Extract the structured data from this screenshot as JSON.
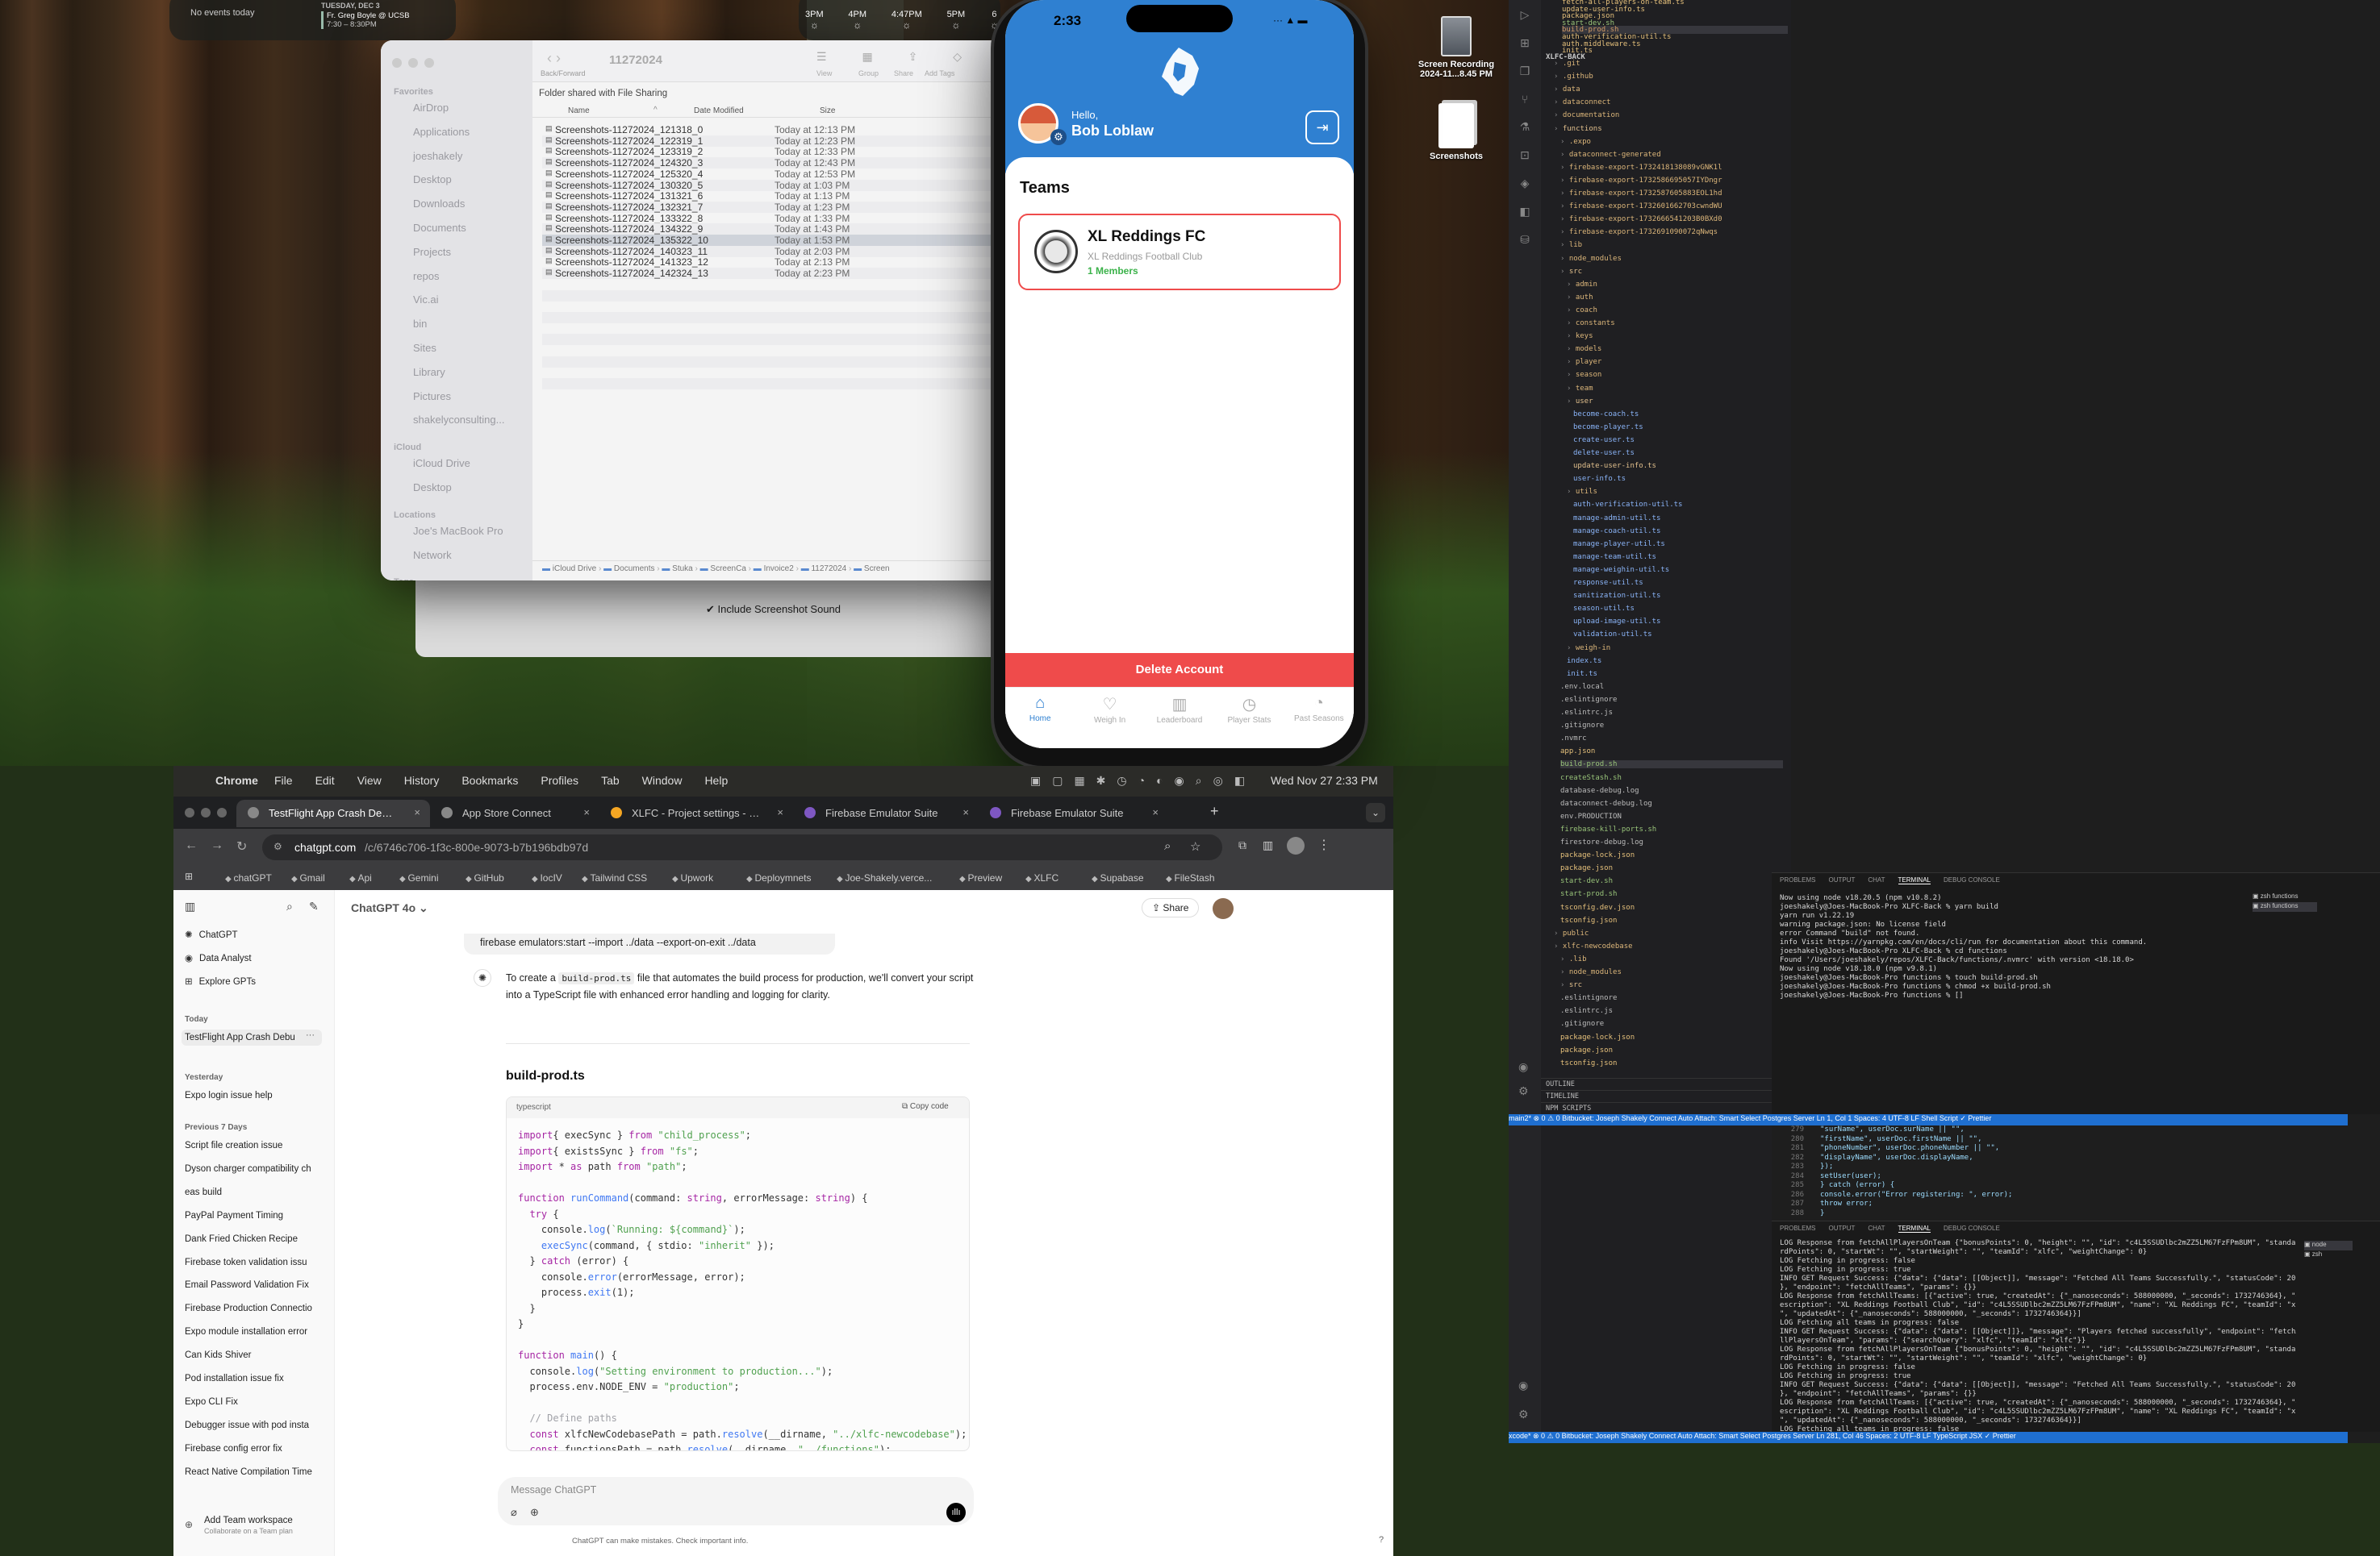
{
  "menubar": {
    "app": "Chrome",
    "items": [
      "File",
      "Edit",
      "View",
      "History",
      "Bookmarks",
      "Profiles",
      "Tab",
      "Window",
      "Help"
    ],
    "clock": "Wed Nov 27  2:33 PM"
  },
  "calendar_widget": {
    "events": "No events today",
    "day": "TUESDAY, DEC 3",
    "event_title": "Fr. Greg Boyle @ UCSB",
    "event_time": "7:30 – 8:30PM"
  },
  "weather_widget": {
    "times": [
      "3PM",
      "4PM",
      "4:47PM",
      "5PM",
      "6"
    ]
  },
  "desktop_icons": [
    {
      "label": "Screen Recording 2024-11...8.45 PM"
    },
    {
      "label": "Screenshots"
    }
  ],
  "finder": {
    "path_title": "11272024",
    "toolbar": {
      "back_forward": "Back/Forward",
      "view": "View",
      "group": "Group",
      "share": "Share",
      "add_tags": "Add Tags"
    },
    "banner": "Folder shared with File Sharing",
    "columns": [
      "Name",
      "Date Modified",
      "Size"
    ],
    "sidebar": {
      "favorites_header": "Favorites",
      "favorites": [
        "AirDrop",
        "Applications",
        "joeshakely",
        "Desktop",
        "Downloads",
        "Documents",
        "Projects",
        "repos",
        "Vic.ai",
        "bin",
        "Sites",
        "Library",
        "Pictures",
        "shakelyconsulting..."
      ],
      "icloud_header": "iCloud",
      "icloud": [
        "iCloud Drive",
        "Desktop"
      ],
      "locations_header": "Locations",
      "locations": [
        "Joe's MacBook Pro",
        "Network"
      ],
      "tags_header": "Tags"
    },
    "files": [
      {
        "name": "Screenshots-11272024_121318_0",
        "date": "Today at 12:13 PM",
        "size": "2."
      },
      {
        "name": "Screenshots-11272024_122319_1",
        "date": "Today at 12:23 PM",
        "size": "2."
      },
      {
        "name": "Screenshots-11272024_123319_2",
        "date": "Today at 12:33 PM",
        "size": "2.7"
      },
      {
        "name": "Screenshots-11272024_124320_3",
        "date": "Today at 12:43 PM",
        "size": "2.8"
      },
      {
        "name": "Screenshots-11272024_125320_4",
        "date": "Today at 12:53 PM",
        "size": "2.7"
      },
      {
        "name": "Screenshots-11272024_130320_5",
        "date": "Today at 1:03 PM",
        "size": "2.8"
      },
      {
        "name": "Screenshots-11272024_131321_6",
        "date": "Today at 1:13 PM",
        "size": "2."
      },
      {
        "name": "Screenshots-11272024_132321_7",
        "date": "Today at 1:23 PM",
        "size": "2."
      },
      {
        "name": "Screenshots-11272024_133322_8",
        "date": "Today at 1:33 PM",
        "size": "2.7"
      },
      {
        "name": "Screenshots-11272024_134322_9",
        "date": "Today at 1:43 PM",
        "size": "2."
      },
      {
        "name": "Screenshots-11272024_135322_10",
        "date": "Today at 1:53 PM",
        "size": "2."
      },
      {
        "name": "Screenshots-11272024_140323_11",
        "date": "Today at 2:03 PM",
        "size": "2.8"
      },
      {
        "name": "Screenshots-11272024_141323_12",
        "date": "Today at 2:13 PM",
        "size": "2.8"
      },
      {
        "name": "Screenshots-11272024_142324_13",
        "date": "Today at 2:23 PM",
        "size": "2."
      }
    ],
    "breadcrumb": [
      "iCloud Drive",
      "Documents",
      "Stuka",
      "ScreenCa",
      "Invoice2",
      "11272024",
      "Screen"
    ],
    "screenshot_sound": "Include Screenshot Sound"
  },
  "phone": {
    "time": "2:33",
    "greeting": "Hello,",
    "user_name": "Bob Loblaw",
    "teams_title": "Teams",
    "team": {
      "name": "XL Reddings FC",
      "subtitle": "XL Reddings Football Club",
      "members": "1 Members"
    },
    "delete_button": "Delete Account",
    "tabs": [
      "Home",
      "Weigh In",
      "Leaderboard",
      "Player Stats",
      "Past Seasons"
    ],
    "colors": {
      "primary": "#2f80d1",
      "danger": "#ef4b4b",
      "member": "#3bb24a"
    }
  },
  "chrome": {
    "tabs": [
      "TestFlight App Crash Debugg",
      "App Store Connect",
      "XLFC - Project settings - Fire",
      "Firebase Emulator Suite",
      "Firebase Emulator Suite"
    ],
    "url_host": "chatgpt.com",
    "url_path": "/c/6746c706-1f3c-800e-9073-b7b196bdb97d",
    "bookmarks": [
      "chatGPT",
      "Gmail",
      "Api",
      "Gemini",
      "GitHub",
      "IocIV",
      "Tailwind CSS",
      "Upwork",
      "Deploymnets",
      "Joe-Shakely.verce...",
      "Preview",
      "XLFC",
      "Supabase",
      "FileStash"
    ]
  },
  "chatgpt": {
    "model": "ChatGPT 4o",
    "share": "Share",
    "sidebar_top": [
      "ChatGPT",
      "Data Analyst",
      "Explore GPTs"
    ],
    "today_header": "Today",
    "today": [
      "TestFlight App Crash Debu"
    ],
    "yesterday_header": "Yesterday",
    "yesterday": [
      "Expo login issue help"
    ],
    "prev7_header": "Previous 7 Days",
    "prev7": [
      "Script file creation issue",
      "Dyson charger compatibility ch",
      "eas build",
      "PayPal Payment Timing",
      "Dank Fried Chicken Recipe",
      "Firebase token validation issu",
      "Email Password Validation Fix",
      "Firebase Production Connectio",
      "Expo module installation error",
      "Can Kids Shiver",
      "Pod installation issue fix",
      "Expo CLI Fix",
      "Debugger issue with pod insta",
      "Firebase config error fix",
      "React Native Compilation Time"
    ],
    "add_workspace": "Add Team workspace",
    "add_workspace_sub": "Collaborate on a Team plan",
    "cmd_line": "firebase emulators:start --import ../data --export-on-exit ../data",
    "answer_a": "To create a ",
    "answer_code": "build-prod.ts",
    "answer_b": " file that automates the build process for production, we'll convert your script into a TypeScript file with enhanced error handling and logging for clarity.",
    "heading": "build-prod.ts",
    "lang": "typescript",
    "copy": "Copy code",
    "input_placeholder": "Message ChatGPT",
    "disclaimer": "ChatGPT can make mistakes. Check important info."
  },
  "vscode": {
    "project": "XLFC-BACK",
    "top_files": [
      "fetch-all-players-on-team.ts",
      "update-user-info.ts",
      "package.json",
      "start-dev.sh",
      "build-prod.sh",
      "auth-verification-util.ts",
      "auth.middleware.ts",
      "init.ts"
    ],
    "tree": [
      ".git",
      ".github",
      "data",
      "dataconnect",
      "documentation",
      "functions",
      ".expo",
      "dataconnect-generated",
      "firebase-export-1732418138089vGNK1l",
      "firebase-export-1732586695057IYDngr",
      "firebase-export-1732587605883EOL1hd",
      "firebase-export-1732601662703cwndWU",
      "firebase-export-1732666541203B0BXd0",
      "firebase-export-1732691090072qNwqs",
      "lib",
      "node_modules",
      "src",
      "admin",
      "auth",
      "coach",
      "constants",
      "keys",
      "models",
      "player",
      "season",
      "team",
      "user",
      "become-coach.ts",
      "become-player.ts",
      "create-user.ts",
      "delete-user.ts",
      "update-user-info.ts",
      "user-info.ts",
      "utils",
      "auth-verification-util.ts",
      "manage-admin-util.ts",
      "manage-coach-util.ts",
      "manage-player-util.ts",
      "manage-team-util.ts",
      "manage-weighin-util.ts",
      "response-util.ts",
      "sanitization-util.ts",
      "season-util.ts",
      "upload-image-util.ts",
      "validation-util.ts",
      "weigh-in",
      "index.ts",
      "init.ts",
      ".env.local",
      ".eslintignore",
      ".eslintrc.js",
      ".gitignore",
      ".nvmrc",
      "app.json",
      "build-prod.sh",
      "createStash.sh",
      "database-debug.log",
      "dataconnect-debug.log",
      "env.PRODUCTION",
      "firebase-kill-ports.sh",
      "firestore-debug.log",
      "package-lock.json",
      "package.json",
      "start-dev.sh",
      "start-prod.sh",
      "tsconfig.dev.json",
      "tsconfig.json",
      "public",
      "xlfc-newcodebase",
      ".lib",
      "node_modules",
      "src",
      ".eslintignore",
      ".eslintrc.js",
      ".gitignore",
      "package-lock.json",
      "package.json",
      "tsconfig.json"
    ],
    "outline": "OUTLINE",
    "timeline": "TIMELINE",
    "npm": "NPM SCRIPTS",
    "panel_tabs": [
      "PROBLEMS",
      "OUTPUT",
      "CHAT",
      "TERMINAL",
      "DEBUG CONSOLE"
    ],
    "terminal1": [
      "Now using node v18.20.5 (npm v10.8.2)",
      "joeshakely@Joes-MacBook-Pro XLFC-Back % yarn build",
      "yarn run v1.22.19",
      "warning package.json: No license field",
      "error Command \"build\" not found.",
      "info Visit https://yarnpkg.com/en/docs/cli/run for documentation about this command.",
      "joeshakely@Joes-MacBook-Pro XLFC-Back % cd functions",
      "Found '/Users/joeshakely/repos/XLFC-Back/functions/.nvmrc' with version <18.18.0>",
      "Now using node v18.18.0 (npm v9.8.1)",
      "joeshakely@Joes-MacBook-Pro functions % touch build-prod.sh",
      "joeshakely@Joes-MacBook-Pro functions % chmod +x build-prod.sh",
      "joeshakely@Joes-MacBook-Pro functions % []"
    ],
    "terminal_list1": [
      "zsh functions",
      "zsh functions"
    ],
    "status1": "main2*  ⊗ 0 ⚠ 0   Bitbucket: Joseph Shakely   Connect   Auto Attach: Smart   Select Postgres Server                Ln 1, Col 1   Spaces: 4   UTF-8   LF   Shell Script   ✓ Prettier",
    "code2": [
      "\"surName\", userDoc.surName || \"\",",
      "\"firstName\", userDoc.firstName || \"\",",
      "\"phoneNumber\", userDoc.phoneNumber || \"\",",
      "\"displayName\", userDoc.displayName,",
      "});",
      "setUser(user);",
      "} catch (error) {",
      "console.error(\"Error registering: \", error);",
      "throw error;",
      "}"
    ],
    "code2_lines": [
      "279",
      "280",
      "281",
      "282",
      "283",
      "284",
      "285",
      "286",
      "287",
      "288"
    ],
    "terminal2": [
      "LOG Response from fetchAllPlayersOnTeam {\"bonusPoints\": 0, \"height\": \"\", \"id\": \"c4L5SSUDlbc2mZZ5LM67FzFPm8UM\", \"standa",
      "rdPoints\": 0, \"startWt\": \"\", \"startWeight\": \"\", \"teamId\": \"xlfc\", \"weightChange\": 0}",
      "LOG Fetching in progress: false",
      "LOG Fetching in progress: true",
      "INFO GET Request Success: {\"data\": {\"data\": [[Object]], \"message\": \"Fetched All Teams Successfully.\", \"statusCode\": 200",
      "}, \"endpoint\": \"fetchAllTeams\", \"params\": {}}",
      "LOG Response from fetchAllTeams: [{\"active\": true, \"createdAt\": {\"_nanoseconds\": 588000000, \"_seconds\": 1732746364}, \"d",
      "escription\": \"XL Reddings Football Club\", \"id\": \"c4L5SSUDlbc2mZZ5LM67FzFPm8UM\", \"name\": \"XL Reddings FC\", \"teamId\": \"xlfc",
      "\", \"updatedAt\": {\"_nanoseconds\": 588000000, \"_seconds\": 1732746364}}]",
      "LOG Fetching all teams in progress: false",
      "INFO GET Request Success: {\"data\": {\"data\": [[Object]]}, \"message\": \"Players fetched successfully\", \"endpoint\": \"fetchA",
      "llPlayersOnTeam\", \"params\": {\"searchQuery\": \"xlfc\", \"teamId\": \"xlfc\"}}",
      "LOG Response from fetchAllPlayersOnTeam {\"bonusPoints\": 0, \"height\": \"\", \"id\": \"c4L5SSUDlbc2mZZ5LM67FzFPm8UM\", \"standa",
      "rdPoints\": 0, \"startWt\": \"\", \"startWeight\": \"\", \"teamId\": \"xlfc\", \"weightChange\": 0}",
      "LOG Fetching in progress: false",
      "LOG Fetching in progress: true",
      "INFO GET Request Success: {\"data\": {\"data\": [[Object]], \"message\": \"Fetched All Teams Successfully.\", \"statusCode\": 200",
      "}, \"endpoint\": \"fetchAllTeams\", \"params\": {}}",
      "LOG Response from fetchAllTeams: [{\"active\": true, \"createdAt\": {\"_nanoseconds\": 588000000, \"_seconds\": 1732746364}, \"d",
      "escription\": \"XL Reddings Football Club\", \"id\": \"c4L5SSUDlbc2mZZ5LM67FzFPm8UM\", \"name\": \"XL Reddings FC\", \"teamId\": \"xlfc",
      "\", \"updatedAt\": {\"_nanoseconds\": 588000000, \"_seconds\": 1732746364}}]",
      "LOG Fetching all teams in progress: false"
    ],
    "terminal_list2": [
      "node",
      "zsh"
    ],
    "status2": "xcode*  ⊗ 0 ⚠ 0   Bitbucket: Joseph Shakely   Connect   Auto Attach: Smart   Select Postgres Server                Ln 281, Col 46   Spaces: 2   UTF-8   LF   TypeScript JSX   ✓ Prettier"
  },
  "code_lines": [
    [
      [
        "kw",
        "import"
      ],
      [
        "",
        "{ execSync } "
      ],
      [
        "kw",
        "from"
      ],
      [
        "",
        " "
      ],
      [
        "str",
        "\"child_process\""
      ],
      [
        "",
        ";"
      ]
    ],
    [
      [
        "kw",
        "import"
      ],
      [
        "",
        "{ existsSync } "
      ],
      [
        "kw",
        "from"
      ],
      [
        "",
        " "
      ],
      [
        "str",
        "\"fs\""
      ],
      [
        "",
        ";"
      ]
    ],
    [
      [
        "kw",
        "import"
      ],
      [
        "",
        " * "
      ],
      [
        "kw",
        "as"
      ],
      [
        "",
        " path "
      ],
      [
        "kw",
        "from"
      ],
      [
        "",
        " "
      ],
      [
        "str",
        "\"path\""
      ],
      [
        "",
        ";"
      ]
    ],
    [
      [
        "",
        ""
      ]
    ],
    [
      [
        "kw",
        "function"
      ],
      [
        "",
        " "
      ],
      [
        "fn",
        "runCommand"
      ],
      [
        "",
        "(command: "
      ],
      [
        "kw",
        "string"
      ],
      [
        "",
        ", errorMessage: "
      ],
      [
        "kw",
        "string"
      ],
      [
        "",
        ") {"
      ]
    ],
    [
      [
        "",
        "  "
      ],
      [
        "kw",
        "try"
      ],
      [
        "",
        " {"
      ]
    ],
    [
      [
        "",
        "    console."
      ],
      [
        "fn",
        "log"
      ],
      [
        "",
        "("
      ],
      [
        "str",
        "`Running: ${command}`"
      ],
      [
        "",
        ");"
      ]
    ],
    [
      [
        "",
        "    "
      ],
      [
        "fn",
        "execSync"
      ],
      [
        "",
        "(command, { stdio: "
      ],
      [
        "str",
        "\"inherit\""
      ],
      [
        "",
        " });"
      ]
    ],
    [
      [
        "",
        "  } "
      ],
      [
        "kw",
        "catch"
      ],
      [
        "",
        " (error) {"
      ]
    ],
    [
      [
        "",
        "    console."
      ],
      [
        "fn",
        "error"
      ],
      [
        "",
        "(errorMessage, error);"
      ]
    ],
    [
      [
        "",
        "    process."
      ],
      [
        "fn",
        "exit"
      ],
      [
        "",
        "(1);"
      ]
    ],
    [
      [
        "",
        "  }"
      ]
    ],
    [
      [
        "",
        "}"
      ]
    ],
    [
      [
        "",
        ""
      ]
    ],
    [
      [
        "kw",
        "function"
      ],
      [
        "",
        " "
      ],
      [
        "fn",
        "main"
      ],
      [
        "",
        "() {"
      ]
    ],
    [
      [
        "",
        "  console."
      ],
      [
        "fn",
        "log"
      ],
      [
        "",
        "("
      ],
      [
        "str",
        "\"Setting environment to production...\""
      ],
      [
        "",
        ");"
      ]
    ],
    [
      [
        "",
        "  process.env.NODE_ENV = "
      ],
      [
        "str",
        "\"production\""
      ],
      [
        "",
        ";"
      ]
    ],
    [
      [
        "",
        ""
      ]
    ],
    [
      [
        "cm",
        "  // Define paths"
      ]
    ],
    [
      [
        "",
        "  "
      ],
      [
        "kw",
        "const"
      ],
      [
        "",
        " xlfcNewCodebasePath = path."
      ],
      [
        "fn",
        "resolve"
      ],
      [
        "",
        "(__dirname, "
      ],
      [
        "str",
        "\"../xlfc-newcodebase\""
      ],
      [
        "",
        ");"
      ]
    ],
    [
      [
        "",
        "  "
      ],
      [
        "kw",
        "const"
      ],
      [
        "",
        " functionsPath = path."
      ],
      [
        "fn",
        "resolve"
      ],
      [
        "",
        "(__dirname, "
      ],
      [
        "str",
        "\"../functions\""
      ],
      [
        "",
        ");"
      ]
    ]
  ]
}
